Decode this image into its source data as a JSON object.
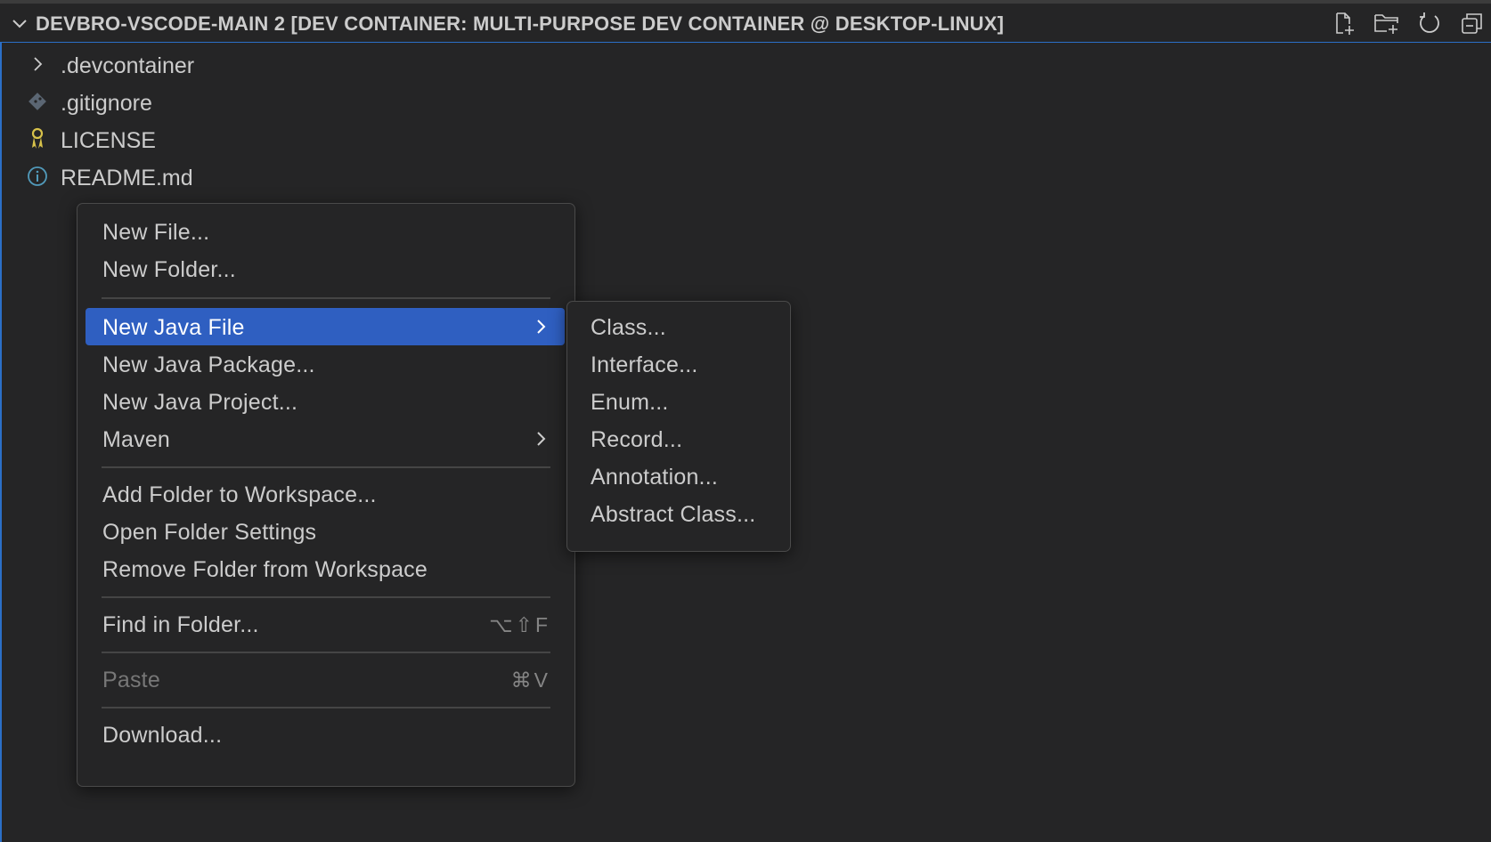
{
  "explorer": {
    "title": "DEVBRO-VSCODE-MAIN 2 [DEV CONTAINER: MULTI-PURPOSE DEV CONTAINER @ DESKTOP-LINUX]",
    "actions": [
      {
        "icon": "new-file-icon"
      },
      {
        "icon": "new-folder-icon"
      },
      {
        "icon": "refresh-icon"
      },
      {
        "icon": "collapse-all-icon"
      }
    ],
    "items": [
      {
        "label": ".devcontainer",
        "icon": "chevron-right-icon"
      },
      {
        "label": ".gitignore",
        "icon": "git-icon"
      },
      {
        "label": "LICENSE",
        "icon": "license-key-icon"
      },
      {
        "label": "README.md",
        "icon": "info-icon"
      }
    ]
  },
  "context_menu": {
    "items": [
      {
        "label": "New File..."
      },
      {
        "label": "New Folder..."
      },
      {
        "label": "New Java File",
        "submenu": true,
        "active": true
      },
      {
        "label": "New Java Package..."
      },
      {
        "label": "New Java Project..."
      },
      {
        "label": "Maven",
        "submenu": true
      },
      {
        "label": "Add Folder to Workspace..."
      },
      {
        "label": "Open Folder Settings"
      },
      {
        "label": "Remove Folder from Workspace"
      },
      {
        "label": "Find in Folder...",
        "shortcut": "⌥⇧F"
      },
      {
        "label": "Paste",
        "shortcut": "⌘V",
        "disabled": true
      },
      {
        "label": "Download..."
      }
    ]
  },
  "submenu": {
    "items": [
      {
        "label": "Class..."
      },
      {
        "label": "Interface..."
      },
      {
        "label": "Enum..."
      },
      {
        "label": "Record..."
      },
      {
        "label": "Annotation..."
      },
      {
        "label": "Abstract Class..."
      }
    ]
  },
  "colors": {
    "background": "#252526",
    "accent": "#2f5fc1",
    "border_accent": "#2b6fc7",
    "text": "#cccccc",
    "disabled_text": "#777777"
  }
}
